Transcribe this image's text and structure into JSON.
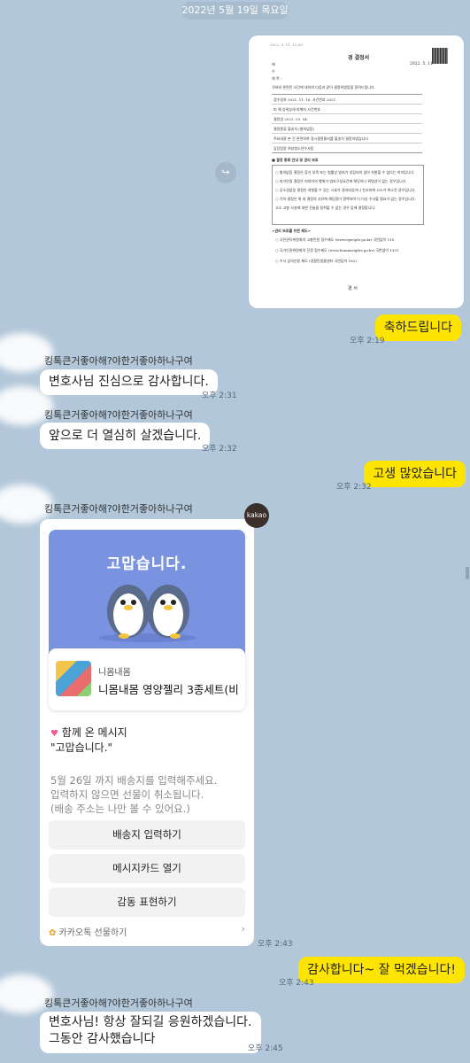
{
  "date": "2022년 5월 19일 목요일",
  "document": {
    "title": "경       결정서",
    "date": "2022. 5. 11.",
    "rows": [
      "접수일자  2021. 11. 16.  사건번호  2021",
      "피   해   상위상세 피해자 사건번호",
      "결정일   2022. 03. 04.",
      "결정종류  불송치 (혐의없음)",
      "주요내용  본 건 관련하여 경시결정통지를 불송치 결정하였습니다",
      "담당팀장  여성청소년수사팀"
    ],
    "section1": "■ 결정 종류 안내 및 권리 보호",
    "section2": "<권리 보호를 위한 제도>",
    "footer": "경   서"
  },
  "messages": {
    "me1": {
      "text": "축하드립니다",
      "time": "오후 2:19"
    },
    "o1": {
      "sender": "킹톡큰거좋아해?야한거좋아하나구여",
      "text": "변호사님 진심으로 감사합니다.",
      "time": "오후 2:31"
    },
    "o2": {
      "sender": "킹톡큰거좋아해?야한거좋아하나구여",
      "text": "앞으로 더 열심히 살겠습니다.",
      "time": "오후 2:32"
    },
    "me2": {
      "text": "고생 많았습니다",
      "time": "오후 2:32"
    },
    "o3": {
      "sender": "킹톡큰거좋아해?야한거좋아하나구여",
      "time": "오후 2:43"
    },
    "me3": {
      "text": "감사합니다~ 잘 먹겠습니다!",
      "time": "오후 2:43"
    },
    "o4": {
      "sender": "킹톡큰거좋아해?야한거좋아하나구여",
      "line1": "변호사님! 항상 잘되길 응원하겠습니다.",
      "line2": "그동안 감사했습니다",
      "time": "오후 2:45"
    }
  },
  "gift": {
    "badge": "kakao",
    "banner_title": "고맙습니다.",
    "brand": "니몸내몸",
    "product": "니몸내몸 영양젤리 3종세트(비..",
    "msg_head": "함께 온 메시지",
    "msg_body": "\"고맙습니다.\"",
    "notice1": "5월 26일 까지 배송지를 입력해주세요.",
    "notice2": "입력하지 않으면 선물이 취소됩니다.",
    "notice3": "(배송 주소는 나만 볼 수 있어요.)",
    "btn_address": "배송지 입력하기",
    "btn_card": "메시지카드 열기",
    "btn_thanks": "감동 표현하기",
    "footer": "카카오톡 선물하기"
  },
  "colors": {
    "background": "#b2c7d9",
    "my_bubble": "#fee500",
    "banner": "#7a93e0"
  }
}
